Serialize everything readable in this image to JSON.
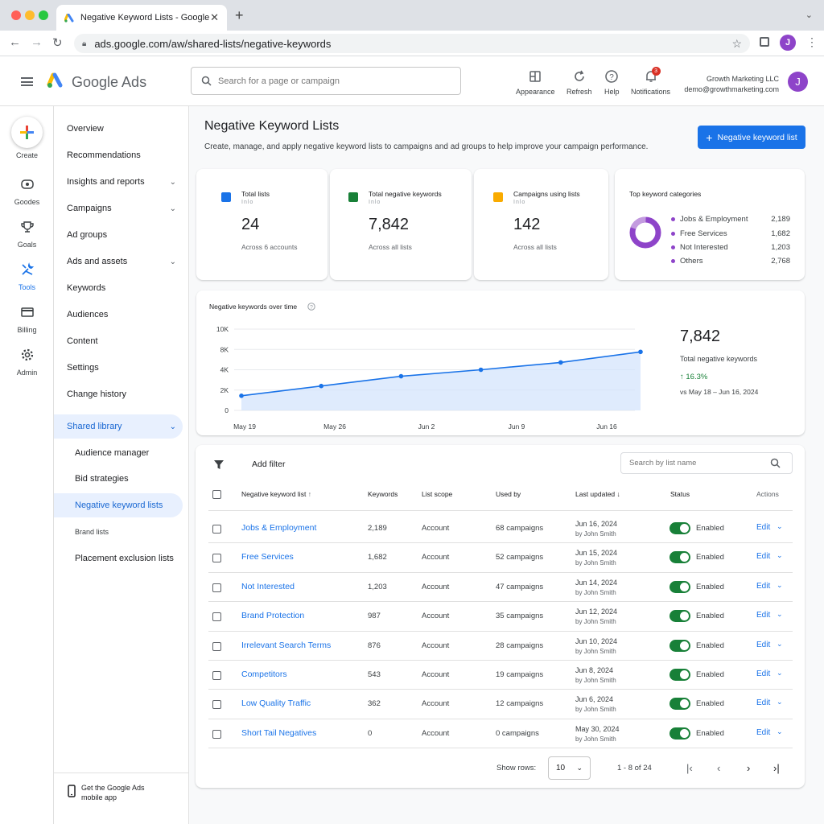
{
  "browser": {
    "tab_title": "Negative Keyword Lists - Google Ads",
    "url": "ads.google.com/aw/shared-lists/negative-keywords",
    "profile_initial": "J",
    "close_glyph": "✕",
    "newtab_glyph": "+"
  },
  "header": {
    "brand": "Google Ads",
    "search_placeholder": "Search for a page or campaign",
    "buttons": {
      "appearance": "Appearance",
      "refresh": "Refresh",
      "help": "Help",
      "notifications": "Notifications"
    },
    "notification_count": "3",
    "account_name": "Growth Marketing LLC",
    "account_email": "demo@growthmarketing.com",
    "avatar_initial": "J"
  },
  "rail": {
    "create": "Create",
    "goals_top": "Goodes",
    "goals": "Goals",
    "tools": "Tools",
    "billing": "Billing",
    "admin": "Admin"
  },
  "nav": {
    "overview": "Overview",
    "recommendations": "Recommendations",
    "insights": "Insights and reports",
    "campaigns": "Campaigns",
    "ad_groups": "Ad groups",
    "ads_assets": "Ads and assets",
    "keywords": "Keywords",
    "audiences": "Audiences",
    "content": "Content",
    "settings": "Settings",
    "change_history": "Change history",
    "shared_library": "Shared library",
    "audience_manager": "Audience manager",
    "bid_strategies": "Bid strategies",
    "negative_keyword_lists": "Negative keyword lists",
    "brand_lists": "Brand lists",
    "placement_exclusion": "Placement exclusion lists",
    "mobile_app": "Get the Google Ads mobile app"
  },
  "page": {
    "title": "Negative Keyword Lists",
    "subtitle": "Create, manage, and apply negative keyword lists to campaigns and ad groups to help improve your campaign performance.",
    "new_button": "Negative keyword list"
  },
  "stats": [
    {
      "label": "Total lists",
      "blur": "Inlo",
      "value": "24",
      "sub": "Across 6 accounts",
      "color": "#1a73e8"
    },
    {
      "label": "Total negative keywords",
      "blur": "Inlo",
      "value": "7,842",
      "sub": "Across all lists",
      "color": "#188038"
    },
    {
      "label": "Campaigns using lists",
      "blur": "Inlo",
      "value": "142",
      "sub": "Across all lists",
      "color": "#f9ab00"
    }
  ],
  "top_categories": {
    "title": "Top keyword categories",
    "items": [
      {
        "name": "Jobs & Employment",
        "value": "2,189"
      },
      {
        "name": "Free Services",
        "value": "1,682"
      },
      {
        "name": "Not Interested",
        "value": "1,203"
      },
      {
        "name": "Others",
        "value": "2,768"
      }
    ],
    "color": "#8e44c9"
  },
  "chart_data": {
    "type": "area",
    "title": "Negative keywords over time",
    "x": [
      "May 19",
      "May 26",
      "Jun 2",
      "Jun 9",
      "Jun 16"
    ],
    "x_points": [
      "May 19",
      "May 23",
      "May 29",
      "Jun 4",
      "Jun 10",
      "Jun 16"
    ],
    "values": [
      1800,
      3000,
      4200,
      5000,
      5900,
      7200
    ],
    "yticks": [
      "10K",
      "8K",
      "4K",
      "2K",
      "0"
    ],
    "ytick_values": [
      10000,
      8000,
      6000,
      4000,
      2000,
      0
    ],
    "ylim": [
      0,
      10000
    ],
    "color": "#1a73e8",
    "grid": true
  },
  "summary": {
    "value": "7,842",
    "label": "Total negative keywords",
    "change": "16.3%",
    "range": "vs May 18 – Jun 16, 2024"
  },
  "table": {
    "add_filter": "Add filter",
    "search_placeholder": "Search by list name",
    "headers": {
      "name": "Negative keyword list",
      "keywords": "Keywords",
      "scope": "List scope",
      "used_by": "Used by",
      "updated": "Last updated",
      "status": "Status",
      "actions": "Actions"
    },
    "rows": [
      {
        "name": "Jobs & Employment",
        "keywords": "2,189",
        "scope": "Account",
        "used_by": "68 campaigns",
        "date": "Jun 16, 2024",
        "by": "by John Smith",
        "status": "Enabled",
        "edit": "Edit"
      },
      {
        "name": "Free Services",
        "keywords": "1,682",
        "scope": "Account",
        "used_by": "52 campaigns",
        "date": "Jun 15, 2024",
        "by": "by John Smith",
        "status": "Enabled",
        "edit": "Edit"
      },
      {
        "name": "Not Interested",
        "keywords": "1,203",
        "scope": "Account",
        "used_by": "47 campaigns",
        "date": "Jun 14, 2024",
        "by": "by John Smith",
        "status": "Enabled",
        "edit": "Edit"
      },
      {
        "name": "Brand Protection",
        "keywords": "987",
        "scope": "Account",
        "used_by": "35 campaigns",
        "date": "Jun 12, 2024",
        "by": "by John Smith",
        "status": "Enabled",
        "edit": "Edit"
      },
      {
        "name": "Irrelevant Search Terms",
        "keywords": "876",
        "scope": "Account",
        "used_by": "28 campaigns",
        "date": "Jun 10, 2024",
        "by": "by John Smith",
        "status": "Enabled",
        "edit": "Edit"
      },
      {
        "name": "Competitors",
        "keywords": "543",
        "scope": "Account",
        "used_by": "19 campaigns",
        "date": "Jun 8, 2024",
        "by": "by John Smith",
        "status": "Enabled",
        "edit": "Edit"
      },
      {
        "name": "Low Quality Traffic",
        "keywords": "362",
        "scope": "Account",
        "used_by": "12 campaigns",
        "date": "Jun 6, 2024",
        "by": "by John Smith",
        "status": "Enabled",
        "edit": "Edit"
      },
      {
        "name": "Short Tail Negatives",
        "keywords": "0",
        "scope": "Account",
        "used_by": "0 campaigns",
        "date": "May 30, 2024",
        "by": "by John Smith",
        "status": "Enabled",
        "edit": "Edit"
      }
    ],
    "show_rows_label": "Show rows:",
    "rows_per_page": "10",
    "range": "1 - 8 of 24"
  }
}
